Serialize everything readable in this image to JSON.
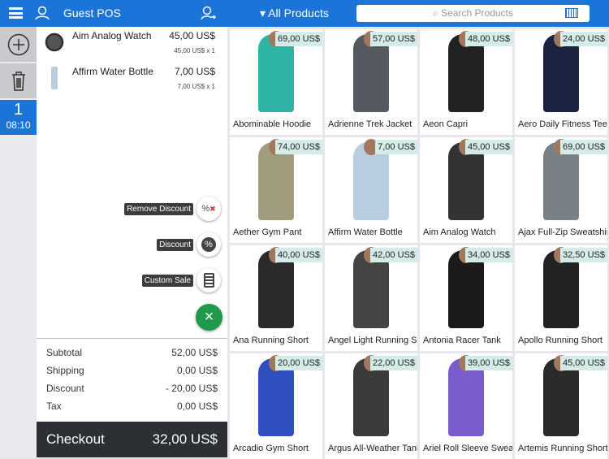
{
  "header": {
    "title": "Guest POS",
    "category": "All Products",
    "search_placeholder": "Search Products"
  },
  "rail": {
    "order_number": "1",
    "order_time": "08:10"
  },
  "cart": {
    "items": [
      {
        "name": "Aim Analog Watch",
        "price": "45,00 US$",
        "qty": "45,00 US$ x 1"
      },
      {
        "name": "Affirm Water Bottle",
        "price": "7,00 US$",
        "qty": "7,00 US$ x 1"
      }
    ],
    "actions": [
      "Remove Discount",
      "Discount",
      "Custom Sale"
    ],
    "totals": [
      {
        "label": "Subtotal",
        "value": "52,00 US$"
      },
      {
        "label": "Shipping",
        "value": "0,00 US$"
      },
      {
        "label": "Discount",
        "value": "- 20,00 US$"
      },
      {
        "label": "Tax",
        "value": "0,00 US$"
      }
    ],
    "checkout_label": "Checkout",
    "checkout_total": "32,00 US$"
  },
  "products": [
    {
      "name": "Abominable Hoodie",
      "price": "69,00 US$",
      "color": "#2fb3a5"
    },
    {
      "name": "Adrienne Trek Jacket",
      "price": "57,00 US$",
      "color": "#555a60"
    },
    {
      "name": "Aeon Capri",
      "price": "48,00 US$",
      "color": "#222"
    },
    {
      "name": "Aero Daily Fitness Tee",
      "price": "24,00 US$",
      "color": "#1c2340"
    },
    {
      "name": "Aether Gym Pant",
      "price": "74,00 US$",
      "color": "#a29c7e"
    },
    {
      "name": "Affirm Water Bottle",
      "price": "7,00 US$",
      "color": "#b8cde0"
    },
    {
      "name": "Aim Analog Watch",
      "price": "45,00 US$",
      "color": "#333"
    },
    {
      "name": "Ajax Full-Zip Sweatshirt",
      "price": "69,00 US$",
      "color": "#7a8088"
    },
    {
      "name": "Ana Running Short",
      "price": "40,00 US$",
      "color": "#2a2a2a"
    },
    {
      "name": "Angel Light Running Short",
      "price": "42,00 US$",
      "color": "#444"
    },
    {
      "name": "Antonia Racer Tank",
      "price": "34,00 US$",
      "color": "#1a1a1a"
    },
    {
      "name": "Apollo Running Short",
      "price": "32,50 US$",
      "color": "#222"
    },
    {
      "name": "Arcadio Gym Short",
      "price": "20,00 US$",
      "color": "#3050c0"
    },
    {
      "name": "Argus All-Weather Tank",
      "price": "22,00 US$",
      "color": "#3a3a3a"
    },
    {
      "name": "Ariel Roll Sleeve Sweatshirt",
      "price": "39,00 US$",
      "color": "#7a5ccc"
    },
    {
      "name": "Artemis Running Short",
      "price": "45,00 US$",
      "color": "#2a2a2a"
    }
  ]
}
